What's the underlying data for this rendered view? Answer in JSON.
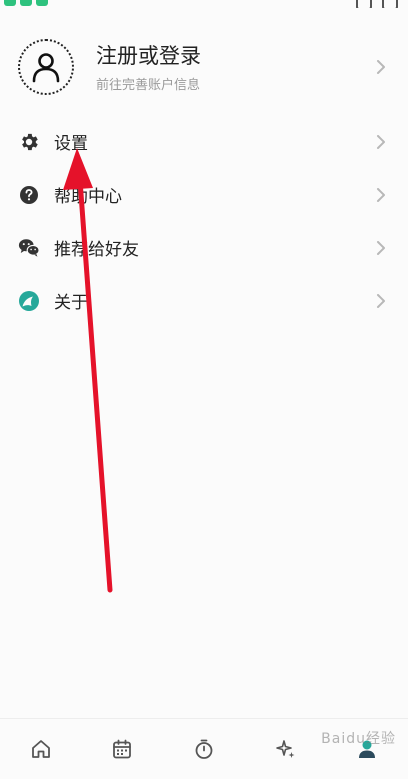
{
  "profile": {
    "title": "注册或登录",
    "subtitle": "前往完善账户信息"
  },
  "menu": [
    {
      "label": "设置",
      "icon": "gear-icon"
    },
    {
      "label": "帮助中心",
      "icon": "help-icon"
    },
    {
      "label": "推荐给好友",
      "icon": "wechat-icon"
    },
    {
      "label": "关于",
      "icon": "app-logo-icon"
    }
  ],
  "bottom_nav": [
    {
      "icon": "home-icon"
    },
    {
      "icon": "calendar-icon"
    },
    {
      "icon": "timer-icon"
    },
    {
      "icon": "sparkle-icon"
    },
    {
      "icon": "profile-icon"
    }
  ],
  "colors": {
    "accent": "#26a89a",
    "arrow": "#e5122a",
    "chevron": "#b8b8b8"
  },
  "watermark": "Baidu经验"
}
